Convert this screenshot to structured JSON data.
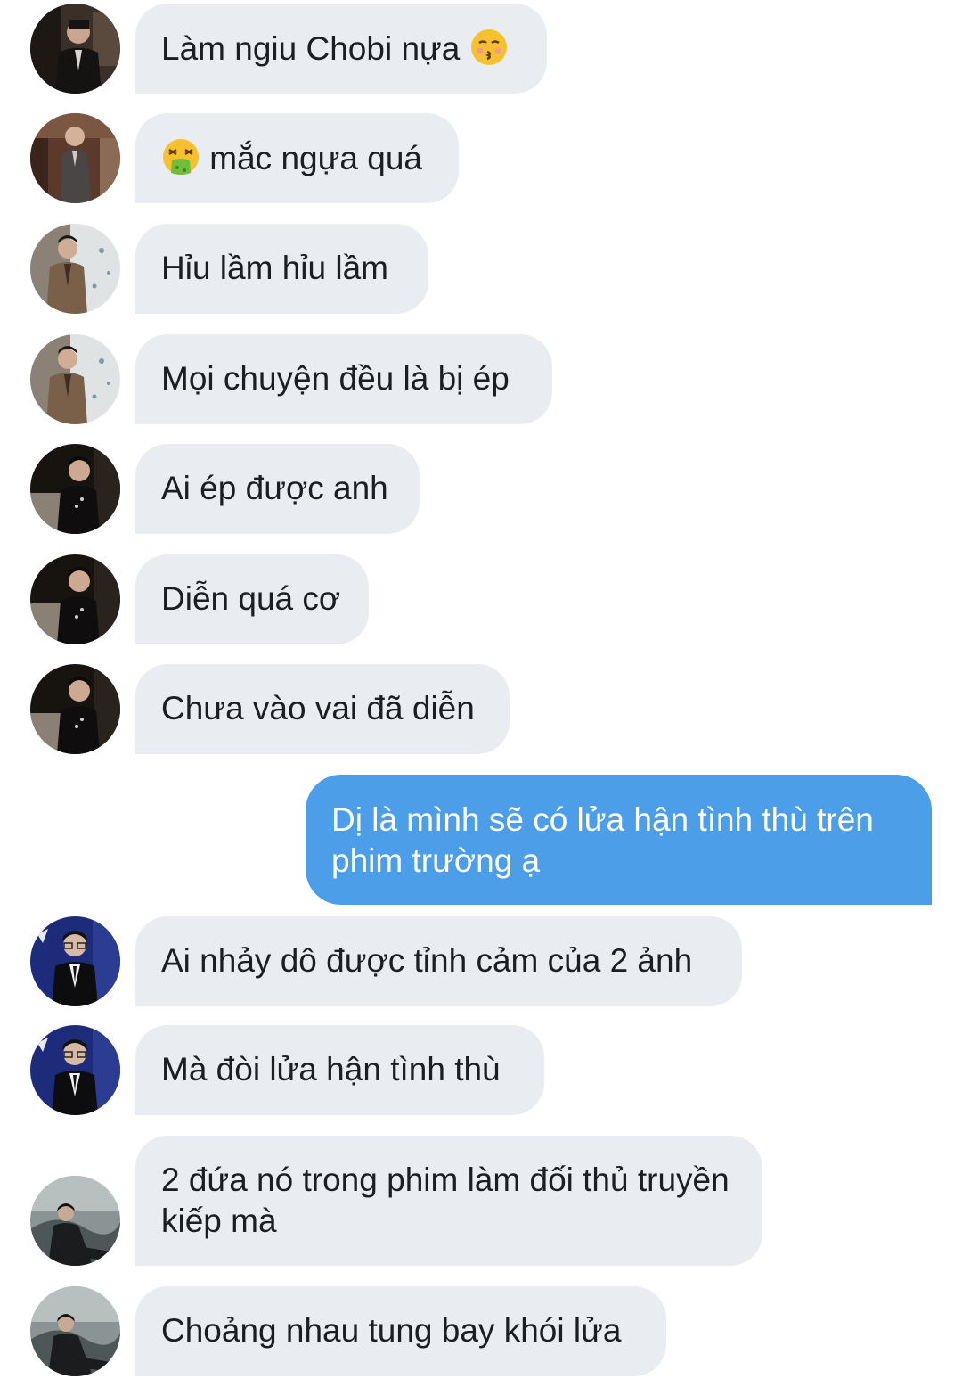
{
  "messages": [
    {
      "text_before": "Làm ngiu Chobi nựa ",
      "emoji": "kissing-face-icon",
      "text_after": "",
      "avatar": "avatar-dark-suit"
    },
    {
      "text_before": "",
      "emoji": "vomiting-face-icon",
      "text_after": " mắc ngựa quá",
      "avatar": "avatar-suit-seated"
    },
    {
      "text": "Hỉu lầm hỉu lầm",
      "avatar": "avatar-light-wall"
    },
    {
      "text": "Mọi chuyện đều là bị ép",
      "avatar": "avatar-light-wall"
    },
    {
      "text": "Ai ép được anh",
      "avatar": "avatar-black-jacket"
    },
    {
      "text": "Diễn quá cơ",
      "avatar": "avatar-black-jacket"
    },
    {
      "text": "Chưa vào vai đã diễn",
      "avatar": "avatar-black-jacket"
    },
    {
      "text": "Dị là mình sẽ có lửa hận tình thù trên phim trường ạ",
      "outgoing": true
    },
    {
      "text": "Ai nhảy dô được tỉnh cảm của 2 ảnh",
      "avatar": "avatar-blue-event"
    },
    {
      "text": "Mà đòi lửa hận tình thù",
      "avatar": "avatar-blue-event"
    },
    {
      "text": "2 đứa nó trong phim làm đối thủ truyền kiếp mà",
      "avatar": "avatar-misty-scene"
    },
    {
      "text": "Choảng nhau tung bay khói lửa",
      "avatar": "avatar-misty-scene"
    }
  ],
  "colors": {
    "incoming_bubble": "#e9edf1",
    "outgoing_bubble": "#4c9ee9",
    "incoming_text": "#1c1e21",
    "outgoing_text": "#ffffff"
  }
}
